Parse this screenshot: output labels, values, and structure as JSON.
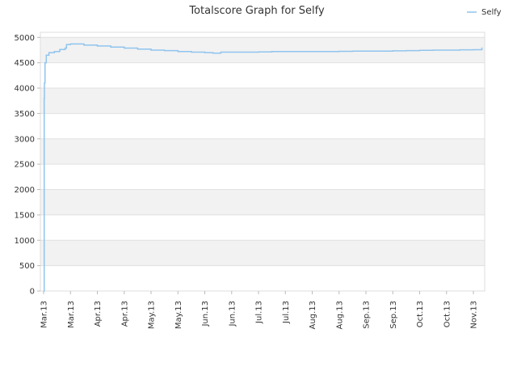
{
  "chart_data": {
    "type": "line",
    "title": "Totalscore Graph for Selfy",
    "xlabel": "",
    "ylabel": "",
    "ylim": [
      0,
      5100
    ],
    "y_ticks": [
      0,
      500,
      1000,
      1500,
      2000,
      2500,
      3000,
      3500,
      4000,
      4500,
      5000
    ],
    "x_tick_labels": [
      "Mar.13",
      "Mar.13",
      "Apr.13",
      "Apr.13",
      "May.13",
      "May.13",
      "Jun.13",
      "Jun.13",
      "Jul.13",
      "Jul.13",
      "Aug.13",
      "Aug.13",
      "Sep.13",
      "Sep.13",
      "Oct.13",
      "Oct.13",
      "Nov.13"
    ],
    "grid": true,
    "legend_position": "top-right",
    "colors": {
      "series": "#90c4ee",
      "band": "#f2f2f2",
      "grid": "#e0e0e0"
    },
    "series": [
      {
        "name": "Selfy",
        "points": [
          [
            0.0,
            0
          ],
          [
            0.02,
            3800
          ],
          [
            0.03,
            4100
          ],
          [
            0.05,
            4500
          ],
          [
            0.1,
            4650
          ],
          [
            0.2,
            4700
          ],
          [
            0.4,
            4720
          ],
          [
            0.6,
            4760
          ],
          [
            0.8,
            4790
          ],
          [
            0.85,
            4860
          ],
          [
            1.0,
            4870
          ],
          [
            1.5,
            4850
          ],
          [
            2.0,
            4830
          ],
          [
            2.5,
            4810
          ],
          [
            3.0,
            4790
          ],
          [
            3.5,
            4770
          ],
          [
            4.0,
            4750
          ],
          [
            4.5,
            4740
          ],
          [
            5.0,
            4720
          ],
          [
            5.5,
            4710
          ],
          [
            6.0,
            4700
          ],
          [
            6.3,
            4690
          ],
          [
            6.6,
            4710
          ],
          [
            7.0,
            4710
          ],
          [
            7.5,
            4710
          ],
          [
            8.0,
            4715
          ],
          [
            8.5,
            4720
          ],
          [
            9.0,
            4720
          ],
          [
            9.5,
            4720
          ],
          [
            10.0,
            4720
          ],
          [
            10.5,
            4720
          ],
          [
            11.0,
            4725
          ],
          [
            11.5,
            4730
          ],
          [
            12.0,
            4730
          ],
          [
            12.5,
            4730
          ],
          [
            13.0,
            4735
          ],
          [
            13.5,
            4740
          ],
          [
            14.0,
            4745
          ],
          [
            14.5,
            4750
          ],
          [
            15.0,
            4750
          ],
          [
            15.5,
            4755
          ],
          [
            16.0,
            4758
          ],
          [
            16.3,
            4760
          ],
          [
            16.32,
            4800
          ]
        ]
      }
    ]
  }
}
